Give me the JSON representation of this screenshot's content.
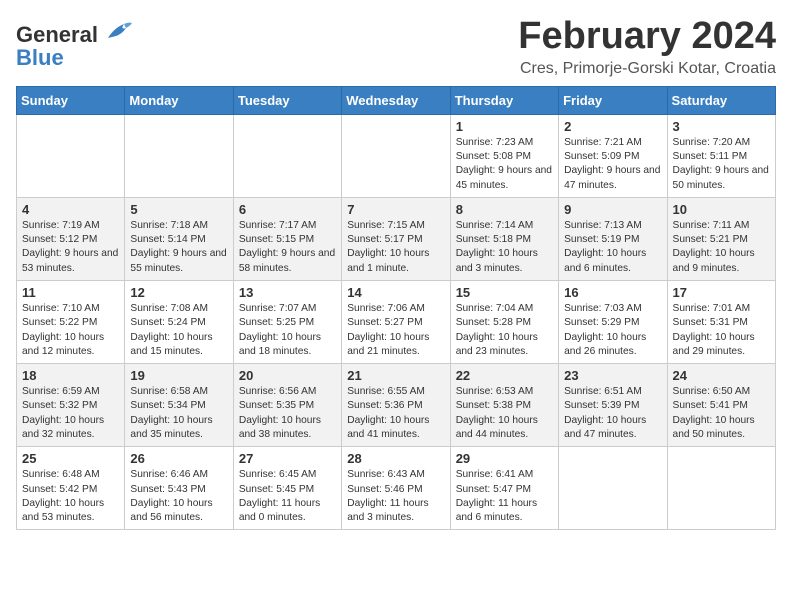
{
  "header": {
    "logo_general": "General",
    "logo_blue": "Blue",
    "month_title": "February 2024",
    "location": "Cres, Primorje-Gorski Kotar, Croatia"
  },
  "weekdays": [
    "Sunday",
    "Monday",
    "Tuesday",
    "Wednesday",
    "Thursday",
    "Friday",
    "Saturday"
  ],
  "weeks": [
    [
      {
        "day": "",
        "info": ""
      },
      {
        "day": "",
        "info": ""
      },
      {
        "day": "",
        "info": ""
      },
      {
        "day": "",
        "info": ""
      },
      {
        "day": "1",
        "info": "Sunrise: 7:23 AM\nSunset: 5:08 PM\nDaylight: 9 hours and 45 minutes."
      },
      {
        "day": "2",
        "info": "Sunrise: 7:21 AM\nSunset: 5:09 PM\nDaylight: 9 hours and 47 minutes."
      },
      {
        "day": "3",
        "info": "Sunrise: 7:20 AM\nSunset: 5:11 PM\nDaylight: 9 hours and 50 minutes."
      }
    ],
    [
      {
        "day": "4",
        "info": "Sunrise: 7:19 AM\nSunset: 5:12 PM\nDaylight: 9 hours and 53 minutes."
      },
      {
        "day": "5",
        "info": "Sunrise: 7:18 AM\nSunset: 5:14 PM\nDaylight: 9 hours and 55 minutes."
      },
      {
        "day": "6",
        "info": "Sunrise: 7:17 AM\nSunset: 5:15 PM\nDaylight: 9 hours and 58 minutes."
      },
      {
        "day": "7",
        "info": "Sunrise: 7:15 AM\nSunset: 5:17 PM\nDaylight: 10 hours and 1 minute."
      },
      {
        "day": "8",
        "info": "Sunrise: 7:14 AM\nSunset: 5:18 PM\nDaylight: 10 hours and 3 minutes."
      },
      {
        "day": "9",
        "info": "Sunrise: 7:13 AM\nSunset: 5:19 PM\nDaylight: 10 hours and 6 minutes."
      },
      {
        "day": "10",
        "info": "Sunrise: 7:11 AM\nSunset: 5:21 PM\nDaylight: 10 hours and 9 minutes."
      }
    ],
    [
      {
        "day": "11",
        "info": "Sunrise: 7:10 AM\nSunset: 5:22 PM\nDaylight: 10 hours and 12 minutes."
      },
      {
        "day": "12",
        "info": "Sunrise: 7:08 AM\nSunset: 5:24 PM\nDaylight: 10 hours and 15 minutes."
      },
      {
        "day": "13",
        "info": "Sunrise: 7:07 AM\nSunset: 5:25 PM\nDaylight: 10 hours and 18 minutes."
      },
      {
        "day": "14",
        "info": "Sunrise: 7:06 AM\nSunset: 5:27 PM\nDaylight: 10 hours and 21 minutes."
      },
      {
        "day": "15",
        "info": "Sunrise: 7:04 AM\nSunset: 5:28 PM\nDaylight: 10 hours and 23 minutes."
      },
      {
        "day": "16",
        "info": "Sunrise: 7:03 AM\nSunset: 5:29 PM\nDaylight: 10 hours and 26 minutes."
      },
      {
        "day": "17",
        "info": "Sunrise: 7:01 AM\nSunset: 5:31 PM\nDaylight: 10 hours and 29 minutes."
      }
    ],
    [
      {
        "day": "18",
        "info": "Sunrise: 6:59 AM\nSunset: 5:32 PM\nDaylight: 10 hours and 32 minutes."
      },
      {
        "day": "19",
        "info": "Sunrise: 6:58 AM\nSunset: 5:34 PM\nDaylight: 10 hours and 35 minutes."
      },
      {
        "day": "20",
        "info": "Sunrise: 6:56 AM\nSunset: 5:35 PM\nDaylight: 10 hours and 38 minutes."
      },
      {
        "day": "21",
        "info": "Sunrise: 6:55 AM\nSunset: 5:36 PM\nDaylight: 10 hours and 41 minutes."
      },
      {
        "day": "22",
        "info": "Sunrise: 6:53 AM\nSunset: 5:38 PM\nDaylight: 10 hours and 44 minutes."
      },
      {
        "day": "23",
        "info": "Sunrise: 6:51 AM\nSunset: 5:39 PM\nDaylight: 10 hours and 47 minutes."
      },
      {
        "day": "24",
        "info": "Sunrise: 6:50 AM\nSunset: 5:41 PM\nDaylight: 10 hours and 50 minutes."
      }
    ],
    [
      {
        "day": "25",
        "info": "Sunrise: 6:48 AM\nSunset: 5:42 PM\nDaylight: 10 hours and 53 minutes."
      },
      {
        "day": "26",
        "info": "Sunrise: 6:46 AM\nSunset: 5:43 PM\nDaylight: 10 hours and 56 minutes."
      },
      {
        "day": "27",
        "info": "Sunrise: 6:45 AM\nSunset: 5:45 PM\nDaylight: 11 hours and 0 minutes."
      },
      {
        "day": "28",
        "info": "Sunrise: 6:43 AM\nSunset: 5:46 PM\nDaylight: 11 hours and 3 minutes."
      },
      {
        "day": "29",
        "info": "Sunrise: 6:41 AM\nSunset: 5:47 PM\nDaylight: 11 hours and 6 minutes."
      },
      {
        "day": "",
        "info": ""
      },
      {
        "day": "",
        "info": ""
      }
    ]
  ]
}
